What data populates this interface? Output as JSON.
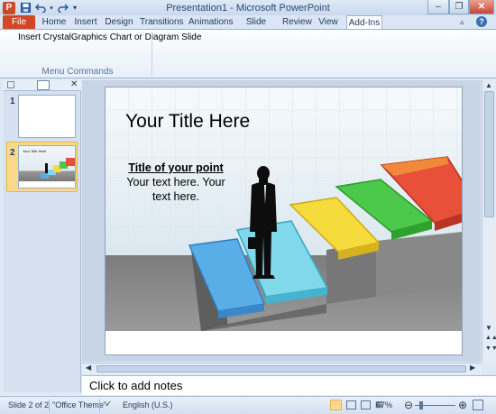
{
  "window": {
    "title": "Presentation1 - Microsoft PowerPoint",
    "app_icon": "P"
  },
  "tabs": [
    {
      "label": "File"
    },
    {
      "label": "Home"
    },
    {
      "label": "Insert"
    },
    {
      "label": "Design"
    },
    {
      "label": "Transitions"
    },
    {
      "label": "Animations"
    },
    {
      "label": "Slide Show"
    },
    {
      "label": "Review"
    },
    {
      "label": "View"
    },
    {
      "label": "Add-Ins"
    }
  ],
  "ribbon": {
    "command": "Insert CrystalGraphics Chart or Diagram Slide",
    "group_label": "Menu Commands"
  },
  "thumbnails": [
    {
      "number": "1"
    },
    {
      "number": "2",
      "mini_title": "Your Title Here"
    }
  ],
  "slide": {
    "title": "Your Title Here",
    "point_title": "Title of your point",
    "point_body": "Your text here. Your text here."
  },
  "notes": {
    "placeholder": "Click to add notes"
  },
  "status": {
    "slide_info": "Slide 2 of 2",
    "theme": "\"Office Theme\"",
    "language": "English (U.S.)",
    "zoom": "67%"
  },
  "colors": {
    "file_tab": "#d24726",
    "step_blue": "#5aaee8",
    "step_cyan": "#7fd9ea",
    "step_yellow": "#f5dc3c",
    "step_green": "#4cc84a",
    "step_red": "#e8503a"
  }
}
